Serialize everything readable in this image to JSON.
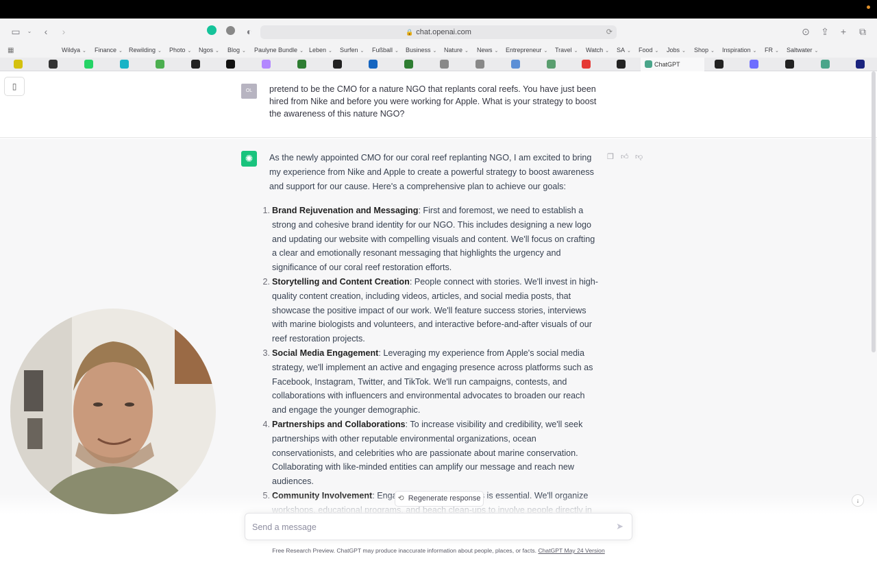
{
  "browser": {
    "url": "chat.openai.com",
    "favorites": [
      {
        "label": "Wildya"
      },
      {
        "label": "Finance"
      },
      {
        "label": "Rewilding"
      },
      {
        "label": "Photo"
      },
      {
        "label": "Ngos"
      },
      {
        "label": "Blog"
      },
      {
        "label": "Paulyne Bundle"
      },
      {
        "label": "Leben"
      },
      {
        "label": "Surfen"
      },
      {
        "label": "Fußball"
      },
      {
        "label": "Business"
      },
      {
        "label": "Nature"
      },
      {
        "label": "News"
      },
      {
        "label": "Entrepreneur"
      },
      {
        "label": "Travel"
      },
      {
        "label": "Watch"
      },
      {
        "label": "SA"
      },
      {
        "label": "Food"
      },
      {
        "label": "Jobs"
      },
      {
        "label": "Shop"
      },
      {
        "label": "Inspiration"
      },
      {
        "label": "FR"
      },
      {
        "label": "Saltwater"
      }
    ],
    "active_tab": "ChatGPT"
  },
  "chat": {
    "user_avatar": "OL",
    "user_message": "pretend to be the CMO for a nature NGO that replants coral reefs. You have just been hired from Nike and before you were working for Apple. What is your strategy to boost the awareness of this nature NGO?",
    "assistant_intro": "As the newly appointed CMO for our coral reef replanting NGO, I am excited to bring my experience from Nike and Apple to create a powerful strategy to boost awareness and support for our cause. Here's a comprehensive plan to achieve our goals:",
    "items": [
      {
        "num": "1.",
        "title": "Brand Rejuvenation and Messaging",
        "text": ": First and foremost, we need to establish a strong and cohesive brand identity for our NGO. This includes designing a new logo and updating our website with compelling visuals and content. We'll focus on crafting a clear and emotionally resonant messaging that highlights the urgency and significance of our coral reef restoration efforts."
      },
      {
        "num": "2.",
        "title": "Storytelling and Content Creation",
        "text": ": People connect with stories. We'll invest in high-quality content creation, including videos, articles, and social media posts, that showcase the positive impact of our work. We'll feature success stories, interviews with marine biologists and volunteers, and interactive before-and-after visuals of our reef restoration projects."
      },
      {
        "num": "3.",
        "title": "Social Media Engagement",
        "text": ": Leveraging my experience from Apple's social media strategy, we'll implement an active and engaging presence across platforms such as Facebook, Instagram, Twitter, and TikTok. We'll run campaigns, contests, and collaborations with influencers and environmental advocates to broaden our reach and engage the younger demographic."
      },
      {
        "num": "4.",
        "title": "Partnerships and Collaborations",
        "text": ": To increase visibility and credibility, we'll seek partnerships with other reputable environmental organizations, ocean conservationists, and celebrities who are passionate about marine conservation. Collaborating with like-minded entities can amplify our message and reach new audiences."
      },
      {
        "num": "5.",
        "title": "Community Involvement",
        "text": ": Engaging local communities is essential. We'll organize workshops, educational programs, and beach clean-ups to involve people directly in our efforts. Community events will foster a sense of ownership and pride in the restoration work we do."
      }
    ],
    "regenerate_label": "Regenerate response",
    "input_placeholder": "Send a message",
    "footer_text": "Free Research Preview. ChatGPT may produce inaccurate information about people, places, or facts. ",
    "footer_link": "ChatGPT May 24 Version"
  }
}
